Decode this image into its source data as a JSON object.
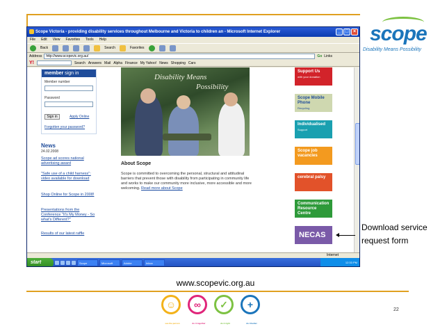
{
  "window": {
    "title": "Scope Victoria - providing disability services throughout Melbourne and Victoria to children an - Microsoft Internet Explorer",
    "menu": [
      "File",
      "Edit",
      "View",
      "Favorites",
      "Tools",
      "Help"
    ],
    "toolbar": [
      "Back",
      "Search",
      "Favorites"
    ],
    "address_label": "Address",
    "address_value": "http://www.scopevic.org.au/",
    "go_label": "Go",
    "links_label": "Links",
    "yahoo_items": [
      "Search",
      "Answers",
      "Mail",
      "Alpha",
      "Finance",
      "My Yahoo!",
      "News",
      "Shopping",
      "Cars"
    ]
  },
  "sidebar": {
    "member_heading_bold": "member",
    "member_heading_rest": " sign in",
    "member_number_label": "Member number",
    "password_label": "Password",
    "signin_label": "Sign in",
    "apply_online": "Apply Online",
    "forgotten_password": "Forgotten your password?",
    "news_title": "News",
    "news_date": "24.02.2008",
    "news_items": [
      "Scope ad scores national advertising award",
      "\"Safe use of a child harness\": video available for download",
      "Shop Online for Scope in 2008!",
      "Presentations from the Conference \"It's My Money - So what's Different?\"",
      "Results of our latest raffle"
    ]
  },
  "main": {
    "hero_line1": "Disability Means",
    "hero_line2": "Possibility",
    "about_title": "About Scope",
    "about_body": "Scope is committed to overcoming the personal, structural and attitudinal barriers that prevent those with disability from participating in community life and works to make our community more inclusive, more accessible and more welcoming. ",
    "about_link": "Read more about Scope"
  },
  "right_buttons": [
    {
      "title": "Support Us",
      "sub": "with your donation",
      "color": "#d2232a"
    },
    {
      "title": "Scope Mobile Phone",
      "sub": "Recycling",
      "color": "#cfd8b0"
    },
    {
      "title": "Individualised",
      "sub": "Support",
      "color": "#1aa0b0"
    },
    {
      "title": "Scope job vacancies",
      "sub": "",
      "color": "#f39a1f"
    },
    {
      "title": "cerebral palsy",
      "sub": "",
      "color": "#e2522a"
    },
    {
      "title": "Communication Resource Centre",
      "sub": "",
      "color": "#2e9a3a"
    },
    {
      "title": "NECAS",
      "sub": "",
      "color": "#7a5aa8"
    }
  ],
  "statusbar": {
    "zone": "Internet"
  },
  "taskbar": {
    "start": "start",
    "tasks": [
      "Scope",
      "Microsoft",
      "Adobe",
      "Inbox"
    ],
    "clock": "12:33 PM"
  },
  "annotation": {
    "text": "Download service request form"
  },
  "slide": {
    "logo_text": "scope",
    "logo_tagline": "Disability Means Possibility",
    "footer_url": "www.scopevic.org.au",
    "page_number": "22",
    "value_icons": [
      {
        "label": "see the person",
        "color": "#f3b21a"
      },
      {
        "label": "do it together",
        "color": "#e0257a"
      },
      {
        "label": "do it right",
        "color": "#7dc242"
      },
      {
        "label": "do it better",
        "color": "#1b75bb"
      }
    ]
  }
}
